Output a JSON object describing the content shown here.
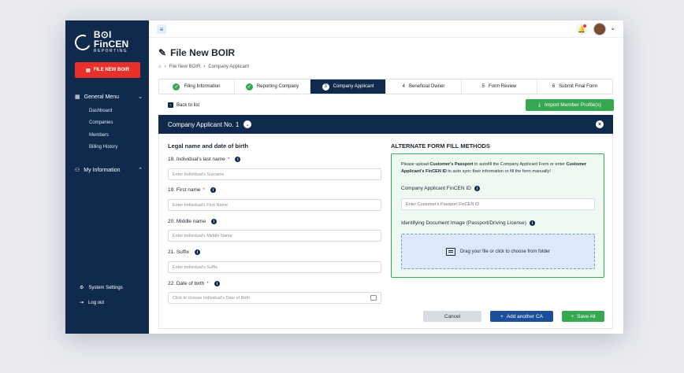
{
  "sidebar": {
    "logo_title": "B⊙I FinCEN",
    "logo_subtitle": "REPORTING",
    "new_button": "FILE NEW BOIR",
    "general_menu": "General Menu",
    "items": [
      "Dashboard",
      "Companies",
      "Members",
      "Billing History"
    ],
    "my_information": "My Information",
    "system_settings": "System Settings",
    "logout": "Log out"
  },
  "page": {
    "title": "File New BOIR",
    "breadcrumb": [
      "File New BOIR",
      "Company Applicant"
    ]
  },
  "steps": [
    {
      "num": "✓",
      "label": "Filing Information",
      "state": "done"
    },
    {
      "num": "✓",
      "label": "Reporting Company",
      "state": "done"
    },
    {
      "num": "3",
      "label": "Company Applicant",
      "state": "active"
    },
    {
      "num": "4",
      "label": "Beneficial Owner",
      "state": "todo"
    },
    {
      "num": "5",
      "label": "Form Review",
      "state": "todo"
    },
    {
      "num": "6",
      "label": "Submit Final Form",
      "state": "todo"
    }
  ],
  "back_label": "Back to list",
  "import_label": "Import Member Profile(s)",
  "applicant_bar": "Company Applicant No. 1",
  "form": {
    "section_title": "Legal name and date of birth",
    "fields": [
      {
        "label": "18. Individual's last name",
        "required": true,
        "placeholder": "Enter Individual's Surname"
      },
      {
        "label": "19. First name",
        "required": true,
        "placeholder": "Enter Individual's First Name"
      },
      {
        "label": "20. Middle name",
        "required": false,
        "placeholder": "Enter Individual's Middle Name"
      },
      {
        "label": "21. Suffix",
        "required": false,
        "placeholder": "Enter Individual's Suffix"
      },
      {
        "label": "22. Date of birth",
        "required": true,
        "placeholder": "Click to choose Individual's Date of Birth"
      }
    ]
  },
  "alt": {
    "title": "ALTERNATE FORM FILL METHODS",
    "text_a": "Please upload ",
    "text_b": "Customer's Passport",
    "text_c": " to autofill the Company Applicant Form or enter ",
    "text_d": "Customer Applicant's FinCEN ID",
    "text_e": " to auto sync their information or fill the form manually!",
    "fincen_label": "Company Applicant FinCEN ID",
    "fincen_placeholder": "Enter Customer's Passport FinCEN ID",
    "doc_label": "Identifying Document Image (Passport/Driving License)",
    "drop_text": "Drag your file or click to choose from folder"
  },
  "buttons": {
    "cancel": "Cancel",
    "add": "Add another CA",
    "save": "Save All"
  },
  "colors": {
    "navy": "#0f2a4d",
    "green": "#36a852",
    "red": "#e8312a",
    "blue": "#1b4f9a"
  }
}
